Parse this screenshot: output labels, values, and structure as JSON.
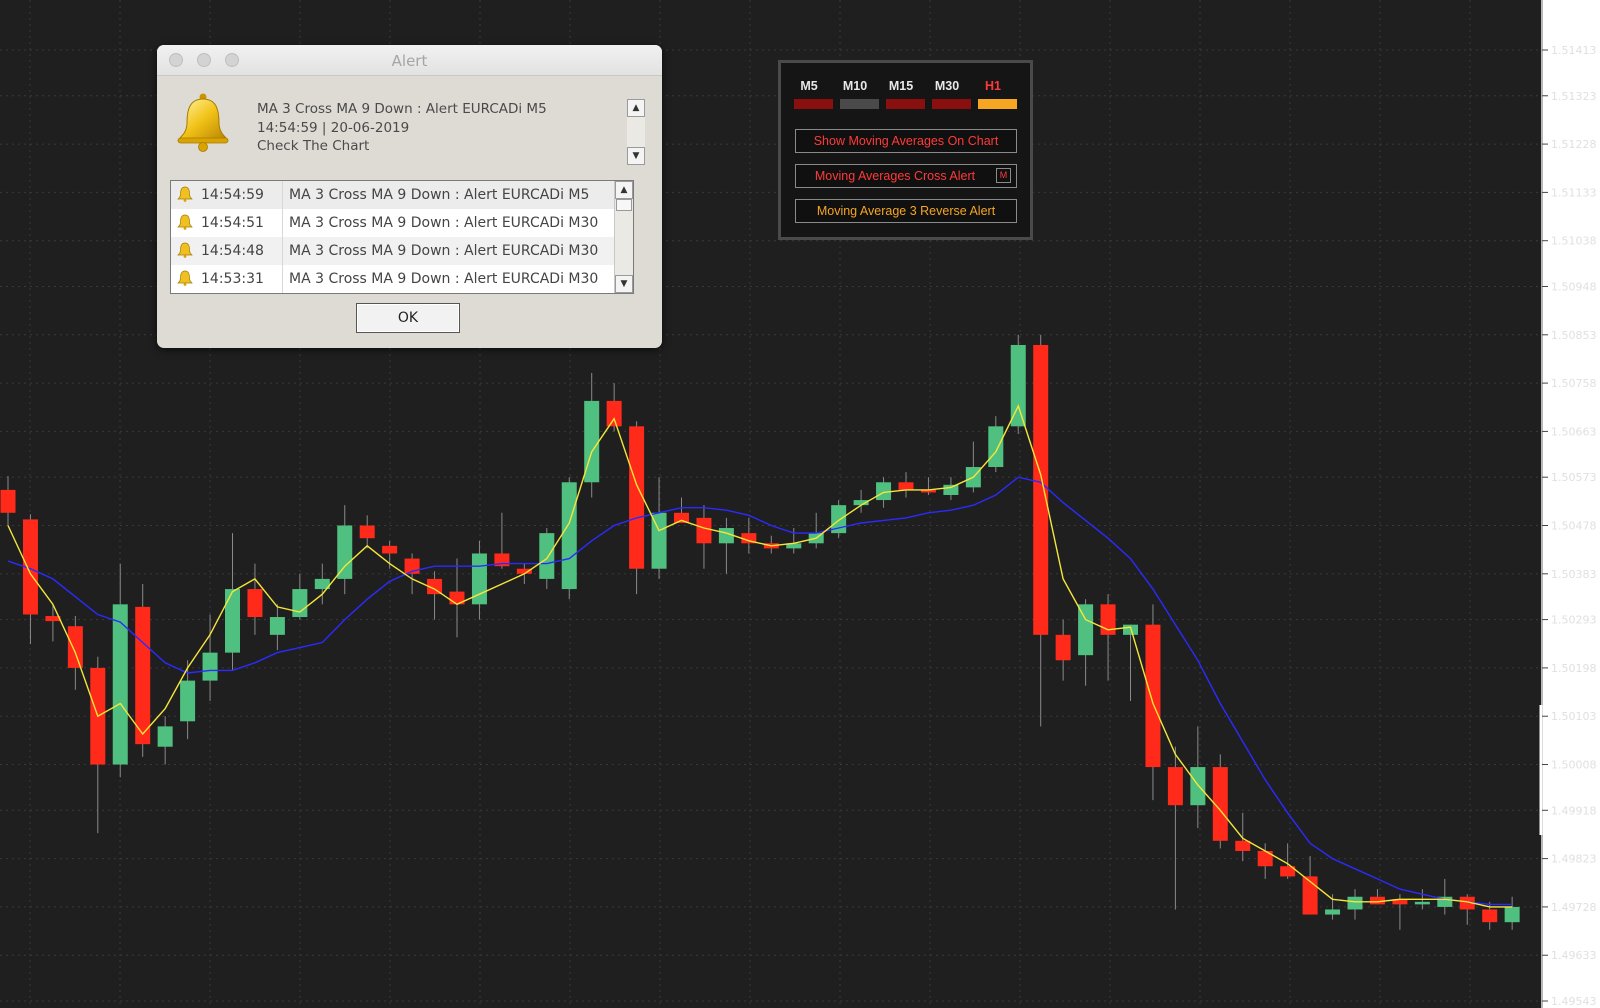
{
  "chart": {
    "price_axis": [
      "1.51413",
      "1.51323",
      "1.51228",
      "1.51133",
      "1.51038",
      "1.50948",
      "1.50853",
      "1.50758",
      "1.50663",
      "1.50573",
      "1.50478",
      "1.50383",
      "1.50293",
      "1.50198",
      "1.50103",
      "1.50008",
      "1.49918",
      "1.49823",
      "1.49728",
      "1.49633",
      "1.49543"
    ],
    "colors": {
      "background": "#1f1f1f",
      "bull": "#50c080",
      "bear": "#ff2a1a",
      "ma_fast": "#f5e63a",
      "ma_slow": "#2b2bff",
      "grid": "#3a3a3a"
    },
    "candles": [
      [
        1.50548,
        1.50575,
        1.50478,
        1.50503
      ],
      [
        1.5049,
        1.505,
        1.50245,
        1.50303
      ],
      [
        1.503,
        1.50323,
        1.5025,
        1.5029
      ],
      [
        1.5028,
        1.503,
        1.50155,
        1.50198
      ],
      [
        1.50198,
        1.5022,
        1.49873,
        1.50008
      ],
      [
        1.50008,
        1.50403,
        1.49983,
        1.50323
      ],
      [
        1.50318,
        1.50363,
        1.50023,
        1.50048
      ],
      [
        1.50043,
        1.50103,
        1.50008,
        1.50083
      ],
      [
        1.50093,
        1.50213,
        1.50058,
        1.50173
      ],
      [
        1.50173,
        1.50303,
        1.50133,
        1.50228
      ],
      [
        1.50228,
        1.50463,
        1.50193,
        1.50353
      ],
      [
        1.50353,
        1.50403,
        1.50263,
        1.50298
      ],
      [
        1.50263,
        1.50323,
        1.50233,
        1.50298
      ],
      [
        1.50298,
        1.50383,
        1.50293,
        1.50353
      ],
      [
        1.50353,
        1.50403,
        1.50323,
        1.50373
      ],
      [
        1.50373,
        1.50518,
        1.50343,
        1.50478
      ],
      [
        1.50478,
        1.50498,
        1.50433,
        1.50453
      ],
      [
        1.50438,
        1.50448,
        1.50393,
        1.50423
      ],
      [
        1.50413,
        1.50423,
        1.50343,
        1.50383
      ],
      [
        1.50373,
        1.50388,
        1.50293,
        1.50343
      ],
      [
        1.50348,
        1.50413,
        1.50258,
        1.50323
      ],
      [
        1.50323,
        1.50448,
        1.50293,
        1.50423
      ],
      [
        1.50423,
        1.50503,
        1.50393,
        1.50398
      ],
      [
        1.50393,
        1.50403,
        1.50363,
        1.50383
      ],
      [
        1.50373,
        1.50473,
        1.50353,
        1.50463
      ],
      [
        1.50353,
        1.50573,
        1.50333,
        1.50563
      ],
      [
        1.50563,
        1.50778,
        1.50533,
        1.50723
      ],
      [
        1.50723,
        1.50758,
        1.50663,
        1.50673
      ],
      [
        1.50673,
        1.50683,
        1.50343,
        1.50393
      ],
      [
        1.50393,
        1.50573,
        1.50373,
        1.50503
      ],
      [
        1.50503,
        1.50533,
        1.50483,
        1.50483
      ],
      [
        1.50493,
        1.50518,
        1.50393,
        1.50443
      ],
      [
        1.50443,
        1.50493,
        1.50383,
        1.50473
      ],
      [
        1.50463,
        1.50493,
        1.50423,
        1.50443
      ],
      [
        1.50443,
        1.50458,
        1.50423,
        1.50433
      ],
      [
        1.50433,
        1.50473,
        1.50423,
        1.50443
      ],
      [
        1.50443,
        1.50503,
        1.50433,
        1.50463
      ],
      [
        1.50463,
        1.50528,
        1.50453,
        1.50518
      ],
      [
        1.50518,
        1.50548,
        1.50503,
        1.50528
      ],
      [
        1.50528,
        1.50573,
        1.50513,
        1.50563
      ],
      [
        1.50563,
        1.50583,
        1.50533,
        1.50548
      ],
      [
        1.50548,
        1.50573,
        1.50538,
        1.50543
      ],
      [
        1.50538,
        1.50573,
        1.50528,
        1.50558
      ],
      [
        1.50553,
        1.50643,
        1.50543,
        1.50593
      ],
      [
        1.50593,
        1.50693,
        1.50583,
        1.50673
      ],
      [
        1.50673,
        1.50853,
        1.50658,
        1.50833
      ],
      [
        1.50833,
        1.50853,
        1.50083,
        1.50263
      ],
      [
        1.50263,
        1.50293,
        1.50173,
        1.50213
      ],
      [
        1.50223,
        1.50333,
        1.50163,
        1.50323
      ],
      [
        1.50323,
        1.50343,
        1.50173,
        1.50263
      ],
      [
        1.50263,
        1.50283,
        1.50133,
        1.50283
      ],
      [
        1.50283,
        1.50323,
        1.49938,
        1.50003
      ],
      [
        1.50003,
        1.50043,
        1.49723,
        1.49928
      ],
      [
        1.49928,
        1.50083,
        1.49883,
        1.50003
      ],
      [
        1.50003,
        1.50028,
        1.49843,
        1.49858
      ],
      [
        1.49858,
        1.49913,
        1.49818,
        1.49838
      ],
      [
        1.49838,
        1.49853,
        1.49783,
        1.49808
      ],
      [
        1.49808,
        1.49853,
        1.49783,
        1.49788
      ],
      [
        1.49788,
        1.49828,
        1.49713,
        1.49713
      ],
      [
        1.49713,
        1.49753,
        1.49703,
        1.49723
      ],
      [
        1.49723,
        1.49763,
        1.49703,
        1.49748
      ],
      [
        1.49748,
        1.49763,
        1.49733,
        1.49733
      ],
      [
        1.49743,
        1.49753,
        1.49683,
        1.49733
      ],
      [
        1.49733,
        1.49763,
        1.49723,
        1.49738
      ],
      [
        1.49728,
        1.49783,
        1.49713,
        1.49748
      ],
      [
        1.49748,
        1.49753,
        1.49693,
        1.49723
      ],
      [
        1.49723,
        1.49738,
        1.49683,
        1.49698
      ],
      [
        1.49698,
        1.49748,
        1.49683,
        1.49728
      ]
    ],
    "ma_fast": [
      1.50478,
      1.50383,
      1.50323,
      1.50228,
      1.50103,
      1.50128,
      1.50068,
      1.50118,
      1.50198,
      1.50263,
      1.50348,
      1.50373,
      1.50318,
      1.50308,
      1.50343,
      1.50398,
      1.50438,
      1.50403,
      1.50373,
      1.50353,
      1.50323,
      1.50343,
      1.50363,
      1.50383,
      1.50413,
      1.50483,
      1.50623,
      1.50688,
      1.50558,
      1.50468,
      1.50488,
      1.50473,
      1.50463,
      1.50448,
      1.50438,
      1.50443,
      1.50453,
      1.50488,
      1.50518,
      1.50543,
      1.50548,
      1.50548,
      1.50553,
      1.50573,
      1.50623,
      1.50713,
      1.50578,
      1.50373,
      1.50293,
      1.50273,
      1.50278,
      1.50128,
      1.50028,
      1.49968,
      1.49918,
      1.49863,
      1.49838,
      1.49813,
      1.49778,
      1.49743,
      1.49738,
      1.49738,
      1.49743,
      1.49743,
      1.49743,
      1.49738,
      1.49728,
      1.49728
    ],
    "ma_slow": [
      1.50408,
      1.50393,
      1.50373,
      1.50338,
      1.50303,
      1.50288,
      1.50248,
      1.50208,
      1.50188,
      1.50193,
      1.50193,
      1.50208,
      1.50228,
      1.50238,
      1.50248,
      1.50293,
      1.50333,
      1.50368,
      1.50388,
      1.50398,
      1.50398,
      1.50398,
      1.50403,
      1.50403,
      1.50403,
      1.50413,
      1.50448,
      1.50478,
      1.50493,
      1.50503,
      1.50513,
      1.50513,
      1.50508,
      1.50498,
      1.50478,
      1.50463,
      1.50463,
      1.50473,
      1.50483,
      1.50488,
      1.50493,
      1.50503,
      1.50508,
      1.50518,
      1.50538,
      1.50573,
      1.50563,
      1.50523,
      1.50488,
      1.50453,
      1.50413,
      1.50353,
      1.50283,
      1.50213,
      1.50128,
      1.50053,
      1.49978,
      1.49913,
      1.49853,
      1.49823,
      1.49803,
      1.49783,
      1.49763,
      1.49753,
      1.49743,
      1.49738,
      1.49733,
      1.49733
    ]
  },
  "alert": {
    "window_title": "Alert",
    "message_line1": "MA 3 Cross MA 9 Down : Alert EURCADi M5",
    "message_line2": "14:54:59 | 20-06-2019",
    "message_line3": "Check The Chart",
    "history": [
      {
        "time": "14:54:59",
        "message": "MA 3 Cross MA 9 Down : Alert EURCADi M5"
      },
      {
        "time": "14:54:51",
        "message": "MA 3 Cross MA 9 Down : Alert EURCADi M30"
      },
      {
        "time": "14:54:48",
        "message": "MA 3 Cross MA 9 Down : Alert EURCADi M30"
      },
      {
        "time": "14:53:31",
        "message": "MA 3 Cross MA 9 Down : Alert EURCADi M30"
      }
    ],
    "ok_label": "OK",
    "icon": "bell-icon"
  },
  "panel": {
    "timeframes": [
      {
        "label": "M5",
        "label_color": "#e8e8e8",
        "bar_color": "#8a0f0f"
      },
      {
        "label": "M10",
        "label_color": "#e8e8e8",
        "bar_color": "#4a4a4a"
      },
      {
        "label": "M15",
        "label_color": "#e8e8e8",
        "bar_color": "#8a0f0f"
      },
      {
        "label": "M30",
        "label_color": "#e8e8e8",
        "bar_color": "#8a0f0f"
      },
      {
        "label": "H1",
        "label_color": "#ff3a3a",
        "bar_color": "#f5a623"
      }
    ],
    "show_ma_label": "Show Moving Averages On Chart",
    "cross_alert_label": "Moving Averages Cross Alert",
    "cross_alert_mode": "M",
    "reverse_alert_label": "Moving Average 3 Reverse Alert",
    "colors": {
      "red_text": "#ff3a3a",
      "orange_text": "#f5a623"
    }
  }
}
